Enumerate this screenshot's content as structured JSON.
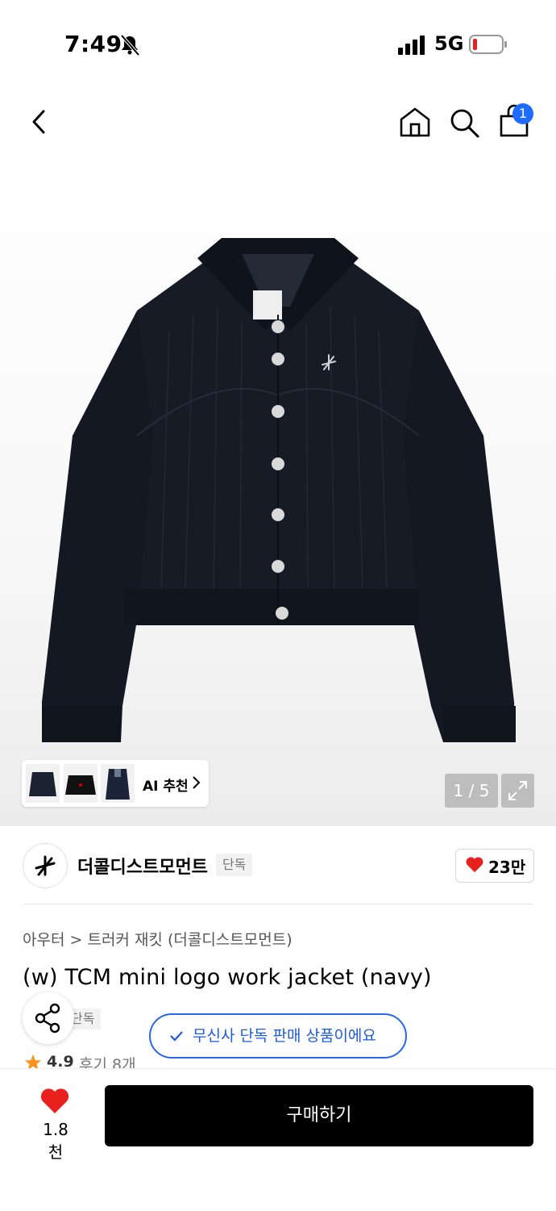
{
  "status_bar": {
    "time": "7:49",
    "network": "5G"
  },
  "header": {
    "cart_count": "1",
    "icons": [
      "back-icon",
      "home-icon",
      "search-icon",
      "shopping-bag-icon"
    ]
  },
  "gallery": {
    "counter": "1 / 5",
    "ai_recommend_label": "AI 추천"
  },
  "brand": {
    "name": "더콜디스트모먼트",
    "tag": "단독",
    "likes": "23만"
  },
  "product": {
    "breadcrumb": [
      "아우터",
      "트러커 재킷 (더콜디스트모먼트)"
    ],
    "title": "(w) TCM mini logo work jacket (navy)",
    "exclusive_tag": "단독",
    "rating": "4.9",
    "reviews": "후기 8개"
  },
  "toast": {
    "text": "무신사 단독 판매 상품이에요"
  },
  "bottom_bar": {
    "wish_count": "1.8천",
    "buy_label": "구매하기"
  },
  "colors": {
    "accent_blue": "#1e6bff",
    "heart_red": "#e8211f",
    "star_orange": "#f7931e",
    "jacket_navy": "#141823"
  }
}
